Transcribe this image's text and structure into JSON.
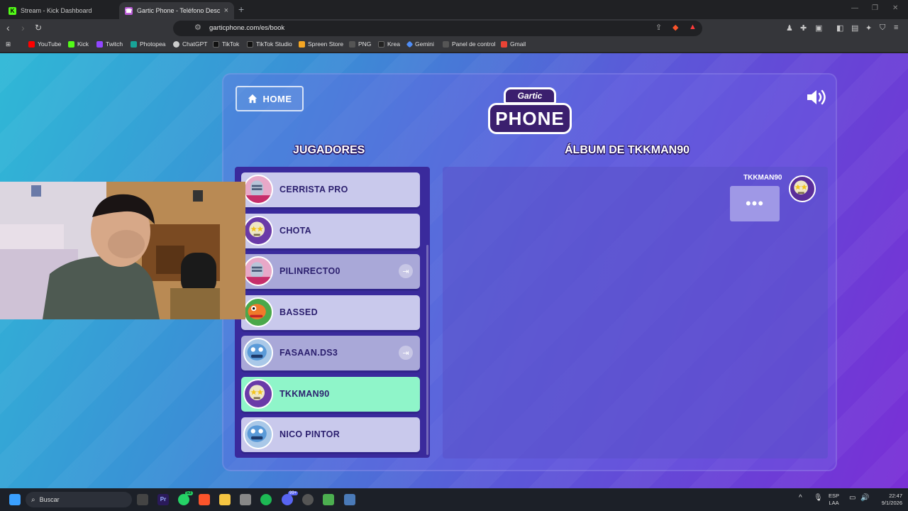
{
  "browser": {
    "tabs": [
      {
        "title": "Stream - Kick Dashboard",
        "favicon": "kick-icon",
        "color": "#53fc18"
      },
      {
        "title": "Gartic Phone - Teléfono Desc",
        "favicon": "gartic-phone-icon",
        "color": "#b95bd6"
      }
    ],
    "url": "garticphone.com/es/book",
    "bookmarks": [
      {
        "label": "YouTube",
        "color": "#ff0000"
      },
      {
        "label": "Kick",
        "color": "#53fc18"
      },
      {
        "label": "Twitch",
        "color": "#9146ff"
      },
      {
        "label": "Photopea",
        "color": "#18a497"
      },
      {
        "label": "ChatGPT",
        "color": "#cccccc"
      },
      {
        "label": "TikTok",
        "color": "#111111"
      },
      {
        "label": "TikTok Studio",
        "color": "#111111"
      },
      {
        "label": "Spreen Store",
        "color": "#f5a623"
      },
      {
        "label": "PNG",
        "color": "#333333"
      },
      {
        "label": "Krea",
        "color": "#222222"
      },
      {
        "label": "Gemini",
        "color": "#4f8df5"
      },
      {
        "label": "Panel de control",
        "color": "#555555"
      },
      {
        "label": "Gmail",
        "color": "#ea4335"
      }
    ]
  },
  "game": {
    "home_label": "HOME",
    "logo_top": "Gartic",
    "logo_bottom": "PHONE",
    "players_heading": "JUGADORES",
    "album_heading": "ÁLBUM DE TKKMAN90",
    "players": [
      {
        "name": "CERRISTA PRO",
        "avatar": "knight-avatar-icon",
        "state": "normal",
        "exit": false
      },
      {
        "name": "CHOTA",
        "avatar": "skull-star-avatar-icon",
        "state": "normal",
        "exit": false
      },
      {
        "name": "PILINRECTO0",
        "avatar": "knight-avatar-icon",
        "state": "dim",
        "exit": true
      },
      {
        "name": "BASSED",
        "avatar": "fish-avatar-icon",
        "state": "normal",
        "exit": false
      },
      {
        "name": "FASAAN.DS3",
        "avatar": "blue-monster-avatar-icon",
        "state": "dim",
        "exit": true
      },
      {
        "name": "TKKMAN90",
        "avatar": "skull-star-avatar-icon",
        "state": "active",
        "exit": false
      },
      {
        "name": "NICO PINTOR",
        "avatar": "blue-monster-avatar-icon",
        "state": "normal",
        "exit": false
      }
    ],
    "album": {
      "author": "TKKMAN90",
      "bubble": "•••"
    }
  },
  "taskbar": {
    "search_placeholder": "Buscar",
    "lang_top": "ESP",
    "lang_bottom": "LAA",
    "time": "22:47",
    "date": "9/1/2026",
    "whatsapp_badge": "53",
    "discord_badge": "99+"
  }
}
